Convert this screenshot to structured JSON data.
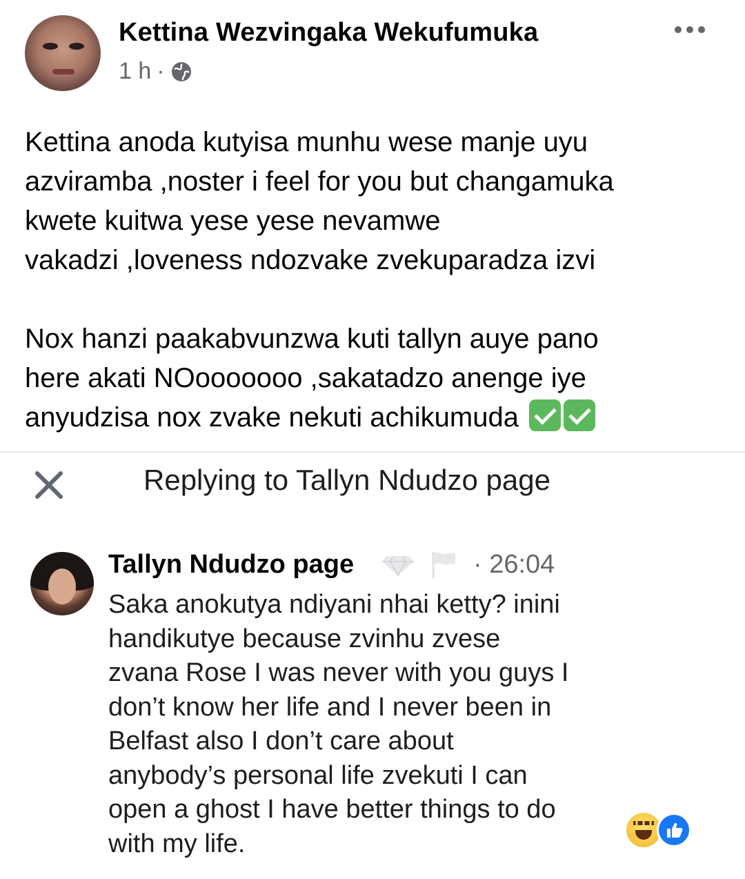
{
  "post": {
    "author": "Kettina Wezvingaka Wekufumuka",
    "time": "1 h",
    "separator": "·",
    "privacy_icon": "globe-icon",
    "more_icon": "more-horizontal-icon",
    "body_lines_p1": [
      "Kettina anoda kutyisa munhu wese manje uyu",
      "azviramba ,noster i feel for you but changamuka",
      "kwete kuitwa yese yese nevamwe",
      "vakadzi ,loveness ndozvake zvekuparadza izvi"
    ],
    "body_lines_p2": [
      "Nox hanzi paakabvunzwa kuti tallyn auye pano",
      "here akati NOooooooo ,sakatadzo anenge iye",
      "anyudzisa nox zvake nekuti achikumuda"
    ],
    "emojis": [
      "check-mark-icon",
      "check-mark-icon"
    ]
  },
  "reply_bar": {
    "close_icon": "close-icon",
    "title": "Replying to Tallyn Ndudzo page"
  },
  "comment": {
    "author": "Tallyn Ndudzo page",
    "badge_icon": "diamond-badge-icon",
    "flag_icon": "flag-icon",
    "time": "· 26:04",
    "lines": [
      "Saka anokutya ndiyani nhai ketty? inini",
      "handikutye because zvinhu zvese",
      "zvana Rose I was never with you guys I",
      "don’t know her life and I never been in",
      "Belfast also I don’t care about",
      "anybody’s personal life zvekuti I can",
      "open a ghost  I have better things to do",
      "with my life."
    ],
    "reactions": [
      "haha-icon",
      "like-icon"
    ]
  }
}
